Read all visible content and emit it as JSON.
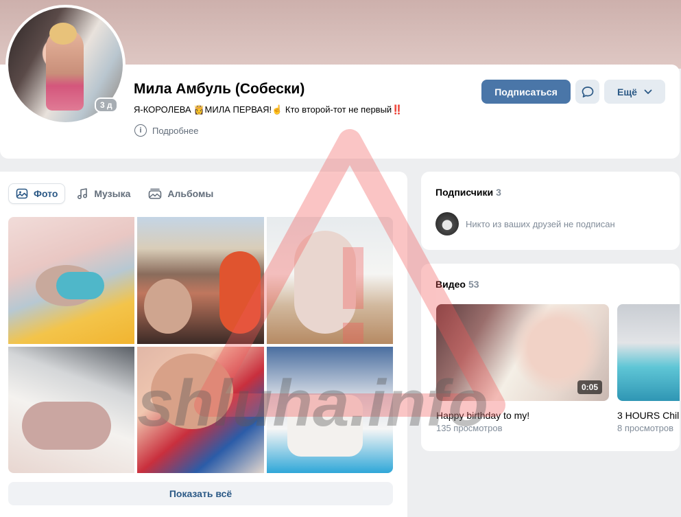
{
  "profile": {
    "name": "Мила Амбуль (Собески)",
    "status": "Я-КОРОЛЕВА 👸МИЛА ПЕРВАЯ!☝️ Кто второй-тот не первый‼️",
    "more_label": "Подробнее",
    "badge": "3 д"
  },
  "actions": {
    "subscribe": "Подписаться",
    "more": "Ещё"
  },
  "tabs": [
    {
      "label": "Фото",
      "icon": "photo-icon",
      "active": true
    },
    {
      "label": "Музыка",
      "icon": "music-icon",
      "active": false
    },
    {
      "label": "Альбомы",
      "icon": "albums-icon",
      "active": false
    }
  ],
  "photos_show_all": "Показать всё",
  "subscribers": {
    "title": "Подписчики",
    "count": "3",
    "note": "Никто из ваших друзей не подписан"
  },
  "videos": {
    "title": "Видео",
    "count": "53",
    "items": [
      {
        "title": "Happy birthday to my!",
        "views": "135 просмотров",
        "duration": "0:05"
      },
      {
        "title": "3 HOURS Chil",
        "views": "8 просмотров",
        "duration": ""
      }
    ]
  },
  "watermark": "shluha.info",
  "colors": {
    "accent": "#4a76a8",
    "link": "#2a5885",
    "secondary_text": "#818c99",
    "background": "#edeef0"
  }
}
